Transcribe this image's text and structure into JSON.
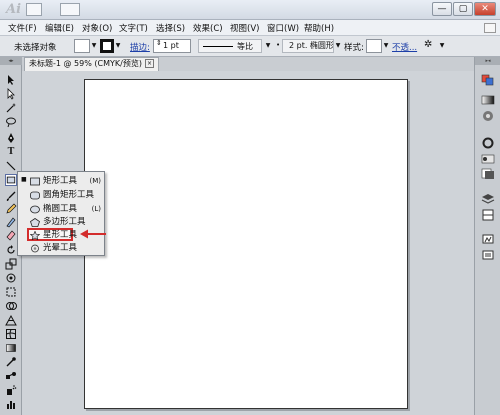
{
  "titlebar": {
    "app_logo": "Ai",
    "minimize": "—",
    "restore": "▢",
    "close": "✕"
  },
  "menu": {
    "items": [
      {
        "label": "文件(F)"
      },
      {
        "label": "编辑(E)"
      },
      {
        "label": "对象(O)"
      },
      {
        "label": "文字(T)"
      },
      {
        "label": "选择(S)"
      },
      {
        "label": "效果(C)"
      },
      {
        "label": "视图(V)"
      },
      {
        "label": "窗口(W)"
      },
      {
        "label": "帮助(H)"
      }
    ]
  },
  "controlbar": {
    "selection_status": "未选择对象",
    "stroke_label": "描边:",
    "stroke_weight": "1 pt",
    "stroke_profile": "等比",
    "brush": "2 pt. 椭圆形",
    "style_label": "样式:",
    "opacity_link": "不透..."
  },
  "document_tab": {
    "title": "未标题-1 @ 59% (CMYK/预览)",
    "close": "×"
  },
  "flyout": {
    "items": [
      {
        "label": "矩形工具",
        "shortcut": "(M)",
        "icon": "rectangle-icon"
      },
      {
        "label": "圆角矩形工具",
        "shortcut": "",
        "icon": "rounded-rectangle-icon"
      },
      {
        "label": "椭圆工具",
        "shortcut": "(L)",
        "icon": "ellipse-icon"
      },
      {
        "label": "多边形工具",
        "shortcut": "",
        "icon": "polygon-icon"
      },
      {
        "label": "星形工具",
        "shortcut": "",
        "icon": "star-icon"
      },
      {
        "label": "光晕工具",
        "shortcut": "",
        "icon": "flare-icon"
      }
    ],
    "selected": "星形工具"
  },
  "colors": {
    "highlight": "#d32c2c",
    "link": "#1d3fa8"
  }
}
